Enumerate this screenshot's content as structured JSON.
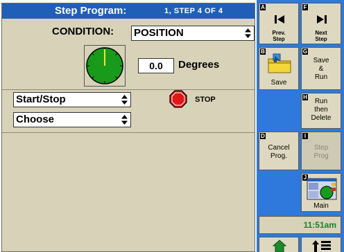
{
  "header": {
    "title": "Step Program:",
    "step_info": "1, STEP  4  OF  4"
  },
  "condition": {
    "label": "CONDITION:",
    "value": "POSITION",
    "degrees_value": "0.0",
    "degrees_label": "Degrees"
  },
  "action": {
    "start_stop_value": "Start/Stop",
    "choose_value": "Choose",
    "stop_label": "STOP"
  },
  "side": {
    "a": {
      "key": "A",
      "label1": "Prev.",
      "label2": "Step"
    },
    "f": {
      "key": "F",
      "label1": "Next",
      "label2": "Step"
    },
    "b": {
      "key": "B",
      "label": "Save"
    },
    "g": {
      "key": "G",
      "label1": "Save",
      "label2": "&",
      "label3": "Run"
    },
    "h": {
      "key": "H",
      "label1": "Run",
      "label2": "then",
      "label3": "Delete"
    },
    "d": {
      "key": "D",
      "label1": "Cancel",
      "label2": "Prog."
    },
    "i": {
      "key": "I",
      "label1": "Step",
      "label2": "Prog"
    },
    "j": {
      "key": "J",
      "label": "Main"
    },
    "time": "11:51am"
  },
  "colors": {
    "title_bar": "#1f5fb8",
    "panel": "#d8d2b8",
    "side_rail": "#2f79dc",
    "time_text": "#0b8a2b",
    "stop_red": "#e01818",
    "dial_green": "#1a9a1a"
  },
  "icons": [
    "prev-step-icon",
    "next-step-icon",
    "save-folder-icon",
    "main-screen-icon",
    "home-icon",
    "prev-screen-icon",
    "stop-sign-icon",
    "position-dial-icon"
  ]
}
